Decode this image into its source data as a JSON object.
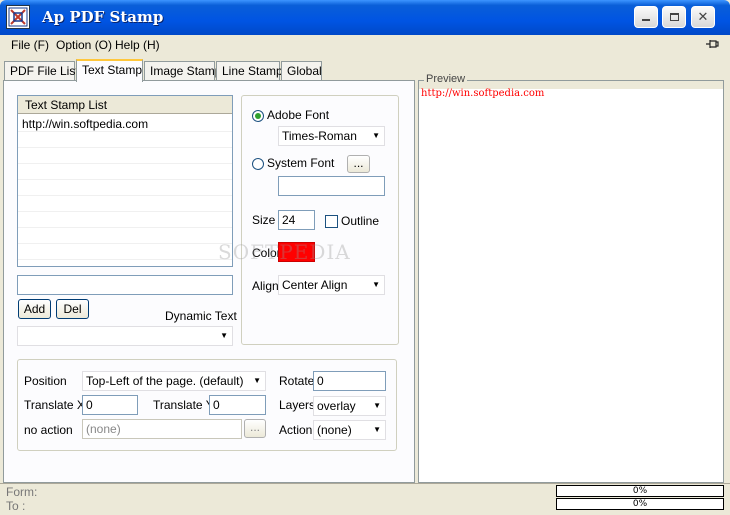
{
  "window": {
    "title": "Ap PDF Stamp"
  },
  "menu": {
    "file": "File (F)",
    "option": "Option (O)",
    "help": "Help (H)"
  },
  "tabs": [
    "PDF File List",
    "Text Stamp",
    "Image Stamp",
    "Line Stamp",
    "Global"
  ],
  "text_stamp": {
    "list_header": "Text Stamp List",
    "list_items": [
      "http://win.softpedia.com"
    ],
    "new_text_value": "",
    "add_label": "Add",
    "del_label": "Del",
    "dynamic_text_label": "Dynamic Text",
    "dynamic_text_value": ""
  },
  "font": {
    "adobe_font_label": "Adobe Font",
    "adobe_font_value": "Times-Roman",
    "system_font_label": "System Font",
    "browse_label": "...",
    "system_font_value": "",
    "size_label": "Size",
    "size_value": "24",
    "outline_label": "Outline",
    "color_label": "Color",
    "color_value": "#ff0000",
    "align_label": "Align",
    "align_value": "Center Align"
  },
  "position": {
    "position_label": "Position",
    "position_value": "Top-Left of the page. (default)",
    "rotate_label": "Rotate",
    "rotate_value": "0",
    "translate_x_label": "Translate X",
    "translate_x_value": "0",
    "translate_y_label": "Translate Y",
    "translate_y_value": "0",
    "layers_label": "Layers",
    "layers_value": "overlay",
    "no_action_label": "no action",
    "no_action_value": "(none)",
    "browse_label": "...",
    "action_label": "Action",
    "action_value": "(none)"
  },
  "preview": {
    "legend": "Preview",
    "text": "http://win.softpedia.com",
    "text_color": "#ff0000"
  },
  "status": {
    "form_label": "Form:",
    "to_label": "To :",
    "progress1": "0%",
    "progress2": "0%"
  },
  "watermark": "SOFTPEDIA"
}
